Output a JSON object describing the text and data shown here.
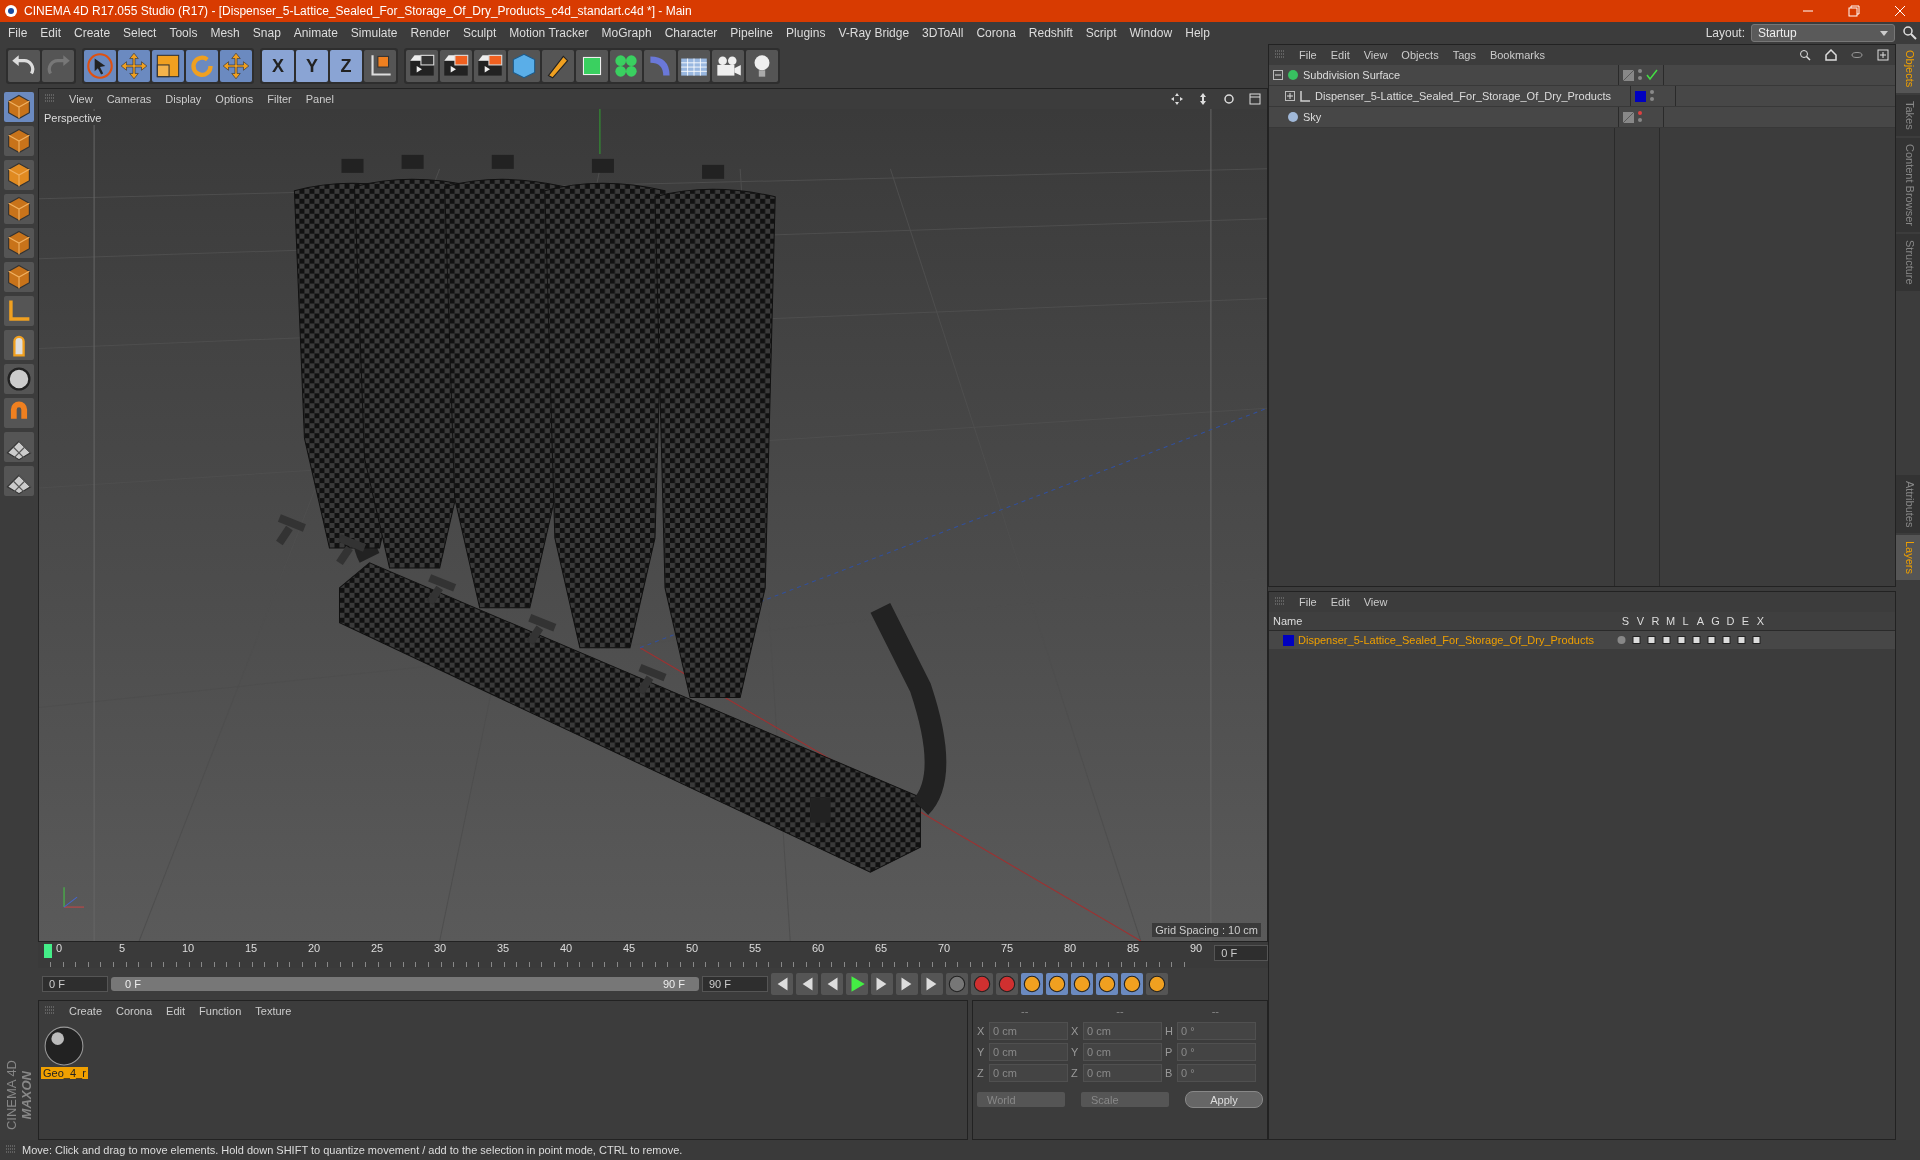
{
  "window": {
    "title": "CINEMA 4D R17.055 Studio (R17) - [Dispenser_5-Lattice_Sealed_For_Storage_Of_Dry_Products_c4d_standart.c4d *] - Main"
  },
  "menu_bar": [
    "File",
    "Edit",
    "Create",
    "Select",
    "Tools",
    "Mesh",
    "Snap",
    "Animate",
    "Simulate",
    "Render",
    "Sculpt",
    "Motion Tracker",
    "MoGraph",
    "Character",
    "Pipeline",
    "Plugins",
    "V-Ray Bridge",
    "3DToAll",
    "Corona",
    "Redshift",
    "Script",
    "Window",
    "Help"
  ],
  "layout": {
    "label": "Layout:",
    "value": "Startup"
  },
  "axis_buttons": [
    {
      "label": "X",
      "selected": true
    },
    {
      "label": "Y",
      "selected": true
    },
    {
      "label": "Z",
      "selected": true
    }
  ],
  "viewport": {
    "menu": [
      "View",
      "Cameras",
      "Display",
      "Options",
      "Filter",
      "Panel"
    ],
    "camera_label": "Perspective",
    "grid_spacing": "Grid Spacing : 10 cm"
  },
  "timeline": {
    "ticks": [
      "0",
      "5",
      "10",
      "15",
      "20",
      "25",
      "30",
      "35",
      "40",
      "45",
      "50",
      "55",
      "60",
      "65",
      "70",
      "75",
      "80",
      "85",
      "90"
    ],
    "current_frame": "0 F",
    "start_field": "0 F",
    "range": {
      "start": "0 F",
      "end": "90 F",
      "level": 1
    },
    "end_field": "90 F"
  },
  "material_manager": {
    "menu": [
      "Create",
      "Corona",
      "Edit",
      "Function",
      "Texture"
    ],
    "materials": [
      {
        "name": "Geo_4_r",
        "selected": true
      }
    ]
  },
  "coordinates": {
    "disabled": true,
    "headers": [
      "--",
      "--",
      "--"
    ],
    "rows": [
      {
        "cells": [
          {
            "axis": "X",
            "value": "0 cm"
          },
          {
            "axis": "X",
            "value": "0 cm"
          },
          {
            "axis": "H",
            "value": "0 °"
          }
        ]
      },
      {
        "cells": [
          {
            "axis": "Y",
            "value": "0 cm"
          },
          {
            "axis": "Y",
            "value": "0 cm"
          },
          {
            "axis": "P",
            "value": "0 °"
          }
        ]
      },
      {
        "cells": [
          {
            "axis": "Z",
            "value": "0 cm"
          },
          {
            "axis": "Z",
            "value": "0 cm"
          },
          {
            "axis": "B",
            "value": "0 °"
          }
        ]
      }
    ],
    "dropdowns": [
      "World",
      "Scale"
    ],
    "apply": "Apply"
  },
  "object_manager": {
    "menu": [
      "File",
      "Edit",
      "View",
      "Objects",
      "Tags",
      "Bookmarks"
    ],
    "objects": [
      {
        "name": "Subdivision Surface",
        "kind": "subdivision",
        "expanded": true,
        "checked": true,
        "render_off": false,
        "children": [
          {
            "name": "Dispenser_5-Lattice_Sealed_For_Storage_Of_Dry_Products",
            "kind": "null",
            "expanded": false,
            "render_off": false,
            "color": "#0000c0"
          }
        ]
      },
      {
        "name": "Sky",
        "kind": "sky",
        "render_off": true
      }
    ]
  },
  "layer_manager": {
    "menu": [
      "File",
      "Edit",
      "View"
    ],
    "columns": [
      "Name",
      "S",
      "V",
      "R",
      "M",
      "L",
      "A",
      "G",
      "D",
      "E",
      "X"
    ],
    "layers": [
      {
        "name": "Dispenser_5-Lattice_Sealed_For_Storage_Of_Dry_Products",
        "color": "#0000c0",
        "selected": true
      }
    ]
  },
  "side_tabs": [
    {
      "label": "Objects",
      "selected": true
    },
    {
      "label": "Takes",
      "selected": false
    },
    {
      "label": "Content Browser",
      "selected": false
    },
    {
      "label": "Structure",
      "selected": false
    }
  ],
  "side_tabs_lower": [
    {
      "label": "Attributes",
      "selected": false
    },
    {
      "label": "Layers",
      "selected": true
    }
  ],
  "brand": {
    "line_1": "MAXON",
    "line_2": "CINEMA 4D"
  },
  "status_bar": "Move: Click and drag to move elements. Hold down SHIFT to quantize movement / add to the selection in point mode, CTRL to remove."
}
